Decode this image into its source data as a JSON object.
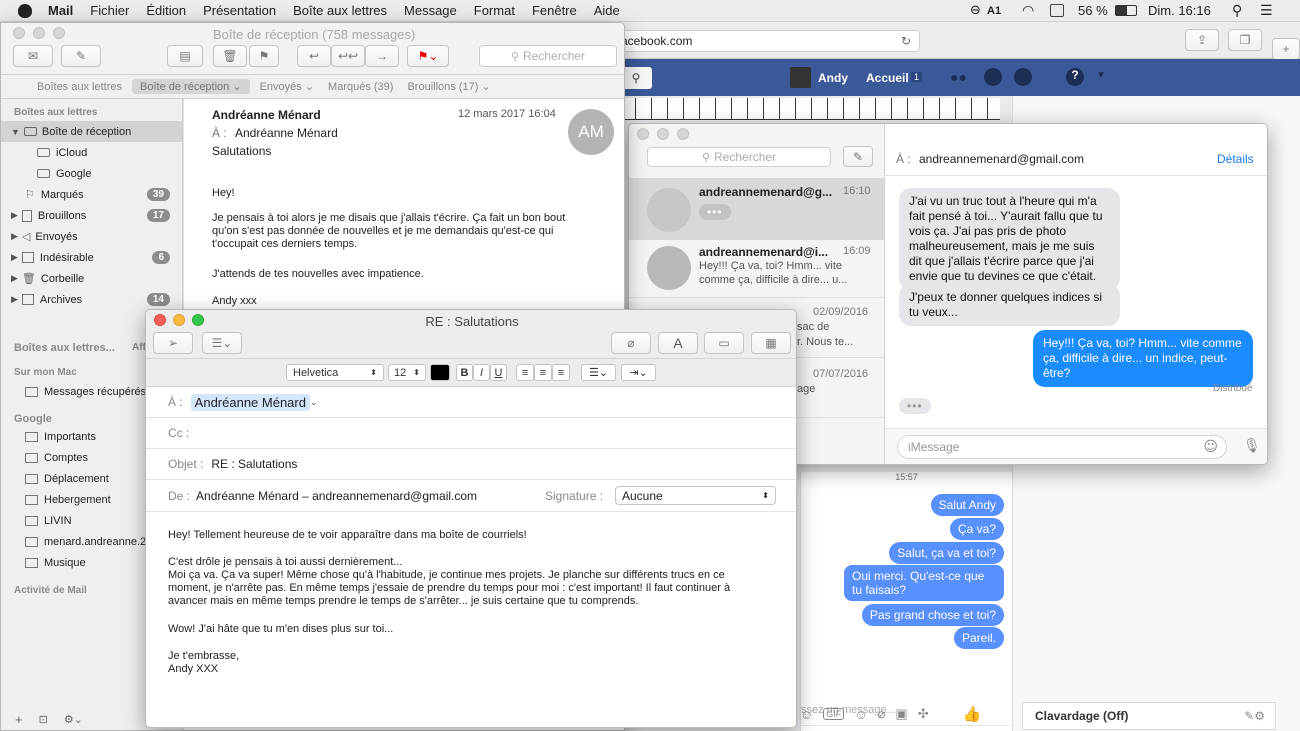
{
  "menubar": {
    "apple_glyph": "",
    "app": "Mail",
    "items": [
      "Fichier",
      "Édition",
      "Présentation",
      "Boîte aux lettres",
      "Message",
      "Format",
      "Fenêtre",
      "Aide"
    ],
    "status": {
      "battery": "56 %",
      "clock": "Dim. 16:16"
    }
  },
  "safari": {
    "url": "acebook.com"
  },
  "facebook": {
    "user": "Andy",
    "home": "Accueil",
    "home_count": "1",
    "chat_time": "15:57",
    "chat_messages": [
      "Salut Andy",
      "Ça va?",
      "Salut, ça va et toi?",
      "Oui merci. Qu'est-ce que tu faisais?",
      "Pas grand chose et toi?",
      "Pareil."
    ],
    "chat_placeholder": "ssez un message...",
    "sidebar_chat": "Clavardage (Off)"
  },
  "messages_app": {
    "search_placeholder": "Rechercher",
    "to_label": "À :",
    "to_value": "andreannemenard@gmail.com",
    "details": "Détails",
    "conversations": [
      {
        "name": "andreannemenard@g...",
        "time": "16:10",
        "preview": "•••"
      },
      {
        "name": "andreannemenard@i...",
        "time": "16:09",
        "preview": "Hey!!! Ça va, toi? Hmm... vite comme ça, difficile à dire... u..."
      },
      {
        "name": "",
        "time": "02/09/2016",
        "preview": "sac de\nr. Nous te..."
      },
      {
        "name": "",
        "time": "07/07/2016",
        "preview": "age"
      }
    ],
    "bubbles": [
      {
        "side": "left",
        "text": "J'ai vu un truc tout à l'heure qui m'a fait pensé à toi... Y'aurait fallu que tu vois ça. J'ai pas pris de photo malheureusement, mais je me suis dit que j'allais t'écrire parce que j'ai envie que tu devines ce que c'était."
      },
      {
        "side": "left",
        "text": "J'peux te donner quelques indices si tu veux..."
      },
      {
        "side": "right",
        "text": "Hey!!! Ça va, toi? Hmm... vite comme ça, difficile à dire... un indice, peut-être?"
      }
    ],
    "delivered": "Distribué",
    "typing": "•••",
    "input_placeholder": "iMessage"
  },
  "mail": {
    "window_title": "Boîte de réception (758 messages)",
    "search_placeholder": "Rechercher",
    "favorites": [
      "Boîtes aux lettres",
      "Boîte de réception ⌄",
      "Envoyés ⌄",
      "Marqués (39)",
      "Brouillons (17) ⌄"
    ],
    "sidebar": {
      "section1": "Boîtes aux lettres",
      "inbox": "Boîte de réception",
      "icloud": "iCloud",
      "google": "Google",
      "flagged": "Marqués",
      "flagged_count": "39",
      "drafts": "Brouillons",
      "drafts_count": "17",
      "sent": "Envoyés",
      "junk": "Indésirable",
      "junk_count": "6",
      "trash": "Corbeille",
      "archives": "Archives",
      "archives_count": "14",
      "section2": "Boîtes aux lettres...",
      "section2_right": "Aff",
      "section3": "Sur mon Mac",
      "mac_items": [
        "Messages récupérés"
      ],
      "section4": "Google",
      "google_items": [
        "Importants",
        "Comptes",
        "Déplacement",
        "Hebergement",
        "LIVIN",
        "menard.andreanne.2",
        "Musique"
      ],
      "section5": "Activité de Mail",
      "footer_icons": [
        "+",
        "⊡",
        "⚙⌄"
      ]
    },
    "message": {
      "from": "Andréanne Ménard",
      "date": "12 mars 2017 16:04",
      "to_label": "À :",
      "to": "Andréanne Ménard",
      "subject": "Salutations",
      "avatar": "AM",
      "body": [
        "Hey!",
        "Je pensais à toi alors je me disais que j'allais t'écrire. Ça fait un bon bout qu'on s'est pas donnée de nouvelles et je me demandais qu'est-ce qui t'occupait ces derniers temps.",
        "J'attends de tes nouvelles avec impatience.",
        "Andy xxx"
      ]
    }
  },
  "compose": {
    "title": "RE : Salutations",
    "font": "Helvetica",
    "size": "12",
    "to_label": "À :",
    "to": "Andréanne Ménard",
    "cc_label": "Cc :",
    "subject_label": "Objet :",
    "subject": "RE : Salutations",
    "from_label": "De :",
    "from": "Andréanne Ménard – andreannemenard@gmail.com",
    "signature_label": "Signature :",
    "signature": "Aucune",
    "body": [
      "Hey! Tellement heureuse de te voir apparaître dans ma boîte de courriels!",
      "C'est drôle je pensais à toi aussi dernièrement...",
      "Moi ça va. Ça va super! Même chose qu'à l'habitude, je continue mes projets. Je planche sur différents trucs en ce moment, je n'arrête pas. En même temps j'essaie de prendre du temps pour moi : c'est important! Il faut continuer à avancer mais en même temps prendre le temps de s'arrêter... je suis certaine que tu comprends.",
      "Wow! J'ai hâte que tu m'en dises plus sur toi...",
      "Je t'embrasse,",
      "Andy XXX"
    ]
  }
}
